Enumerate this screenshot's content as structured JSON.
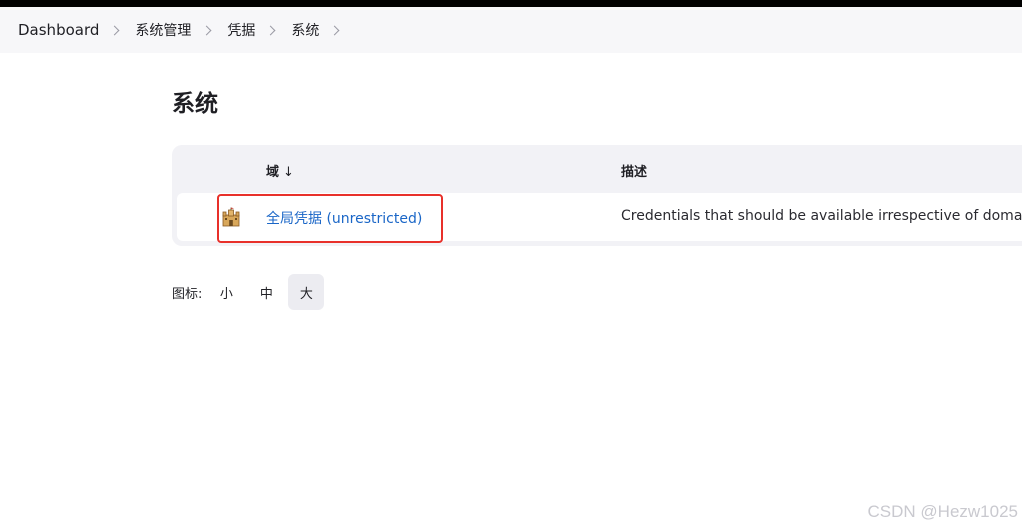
{
  "breadcrumb": {
    "items": [
      "Dashboard",
      "系统管理",
      "凭据",
      "系统"
    ]
  },
  "page": {
    "title": "系统"
  },
  "table": {
    "headers": {
      "domain": "域",
      "sort_indicator": "↓",
      "description": "描述"
    },
    "rows": [
      {
        "icon": "castle-icon",
        "domain": "全局凭据 (unrestricted)",
        "description": "Credentials that should be available irrespective of domain s"
      }
    ]
  },
  "icon_size": {
    "label": "图标:",
    "options": [
      "小",
      "中",
      "大"
    ],
    "selected": "大"
  },
  "colors": {
    "link": "#1a66c7",
    "highlight_box": "#e8302a",
    "breadcrumb_bg": "#f7f7f9",
    "table_bg": "#f2f2f6"
  },
  "watermark": "CSDN @Hezw1025"
}
